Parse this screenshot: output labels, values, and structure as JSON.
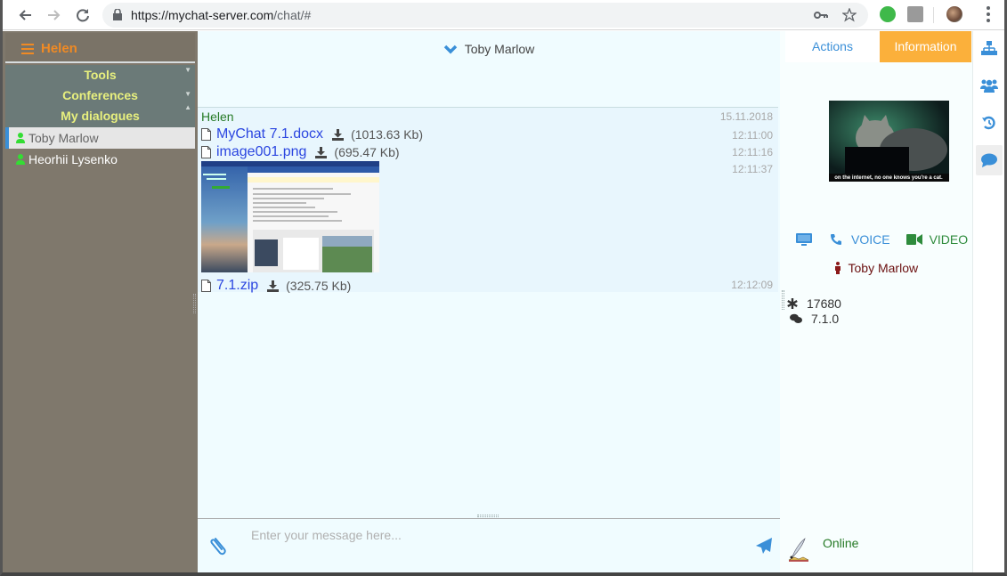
{
  "browser": {
    "url_host": "https://mychat-server.com",
    "url_path": "/chat/#",
    "back_label": "←",
    "forward_label": "→",
    "reload_label": "⟳",
    "key_icon": "key-icon",
    "star_icon": "star-icon"
  },
  "sidebar": {
    "user_name": "Helen",
    "sections": [
      {
        "label": "Tools",
        "arrow": "▼"
      },
      {
        "label": "Conferences",
        "arrow": "▼"
      },
      {
        "label": "My dialogues",
        "arrow": "▲"
      }
    ],
    "contacts": [
      {
        "name": "Toby Marlow",
        "status": "online",
        "active": true
      },
      {
        "name": "Heorhii Lysenko",
        "status": "online",
        "active": false
      }
    ]
  },
  "chat": {
    "title": "Toby Marlow",
    "message": {
      "author": "Helen",
      "date": "15.11.2018",
      "files": [
        {
          "name": "MyChat 7.1.docx",
          "size": "(1013.63 Kb)",
          "time": "12:11:00"
        },
        {
          "name": "image001.png",
          "size": "(695.47 Kb)",
          "time": "12:11:16"
        },
        {
          "name": "7.1.zip",
          "size": "(325.75 Kb)",
          "time": "12:12:09"
        }
      ],
      "image_time": "12:11:37"
    },
    "composer": {
      "placeholder": "Enter your message here...",
      "value": ""
    }
  },
  "info": {
    "tabs": {
      "actions": "Actions",
      "information": "Information"
    },
    "avatar_caption": "on the internet, no one knows you're a cat.",
    "voice_label": "VOICE",
    "video_label": "VIDEO",
    "contact_name": "Toby Marlow",
    "uin": "17680",
    "client_version": "7.1.0",
    "status": "Online"
  },
  "rail": {
    "items": [
      "structure-icon",
      "users-icon",
      "history-icon",
      "chat-icon"
    ],
    "active": "chat-icon"
  },
  "colors": {
    "accent": "#3a8fd8",
    "info_tab": "#fbb03b",
    "username": "#f08a24",
    "section_text": "#e8f07e",
    "online": "#267a26",
    "link": "#2b46e0"
  }
}
